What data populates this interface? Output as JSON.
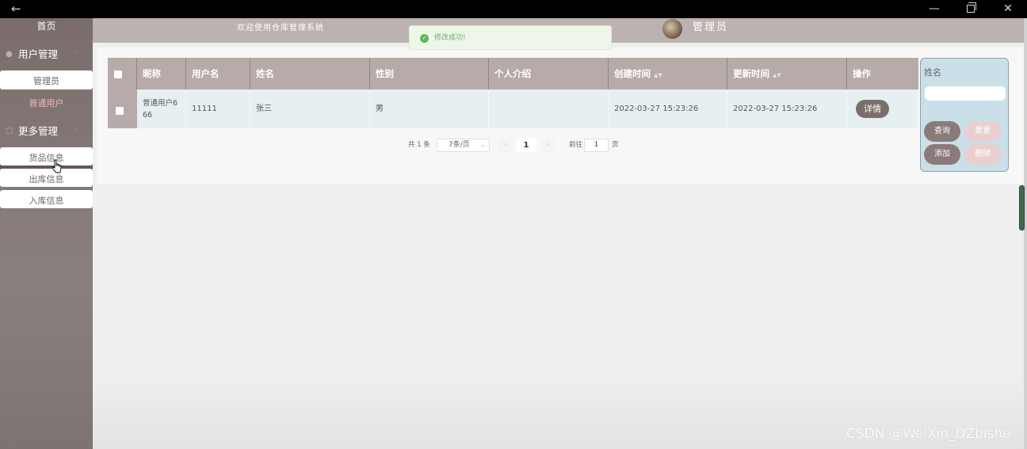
{
  "window": {
    "back": "←",
    "minimize": "—",
    "close": "✕"
  },
  "sidebar": {
    "home": "首页",
    "group1": {
      "label": "用户管理",
      "items": [
        "管理员",
        "普通用户"
      ]
    },
    "group2": {
      "label": "更多管理",
      "items": [
        "货品信息",
        "出库信息",
        "入库信息"
      ]
    }
  },
  "header": {
    "title": "欢迎使用仓库管理系统",
    "user": "管理员"
  },
  "toast": {
    "message": "修改成功!"
  },
  "table": {
    "columns": [
      "昵称",
      "用户名",
      "姓名",
      "性别",
      "个人介绍",
      "创建时间",
      "更新时间",
      "操作"
    ],
    "rows": [
      {
        "nickname": "普通用户6 66",
        "username": "11111",
        "name": "张三",
        "gender": "男",
        "intro": "",
        "created": "2022-03-27 15:23:26",
        "updated": "2022-03-27 15:23:26",
        "action": "详情"
      }
    ]
  },
  "pagination": {
    "total": "共 1 条",
    "page_size": "7条/页",
    "current": "1",
    "goto_label": "前往",
    "goto_value": "1",
    "unit": "页"
  },
  "search": {
    "label": "姓名",
    "query": "查询",
    "reset": "重置",
    "add": "添加",
    "delete": "删除"
  },
  "watermark": "CSDN @WeiXin_DZbishe",
  "colors": {
    "sidebar": "#7a6d6b",
    "header": "#bcb2b0",
    "table_header": "#b6aba9",
    "success": "#67b26a"
  }
}
